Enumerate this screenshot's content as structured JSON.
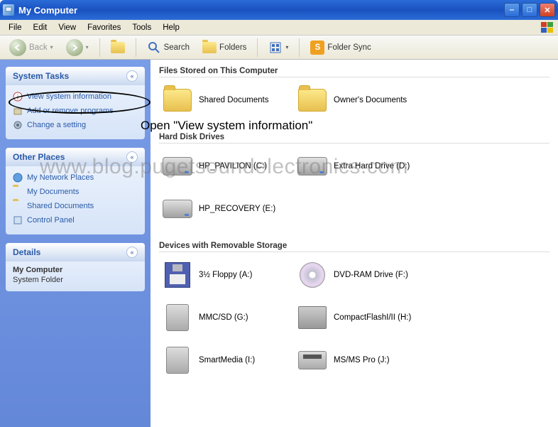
{
  "titlebar": {
    "title": "My Computer"
  },
  "menubar": {
    "items": [
      "File",
      "Edit",
      "View",
      "Favorites",
      "Tools",
      "Help"
    ]
  },
  "toolbar": {
    "back": "Back",
    "search": "Search",
    "folders": "Folders",
    "foldersync": "Folder Sync"
  },
  "sidebar": {
    "system_tasks": {
      "title": "System Tasks",
      "links": [
        {
          "label": "View system information"
        },
        {
          "label": "Add or remove programs"
        },
        {
          "label": "Change a setting"
        }
      ]
    },
    "other_places": {
      "title": "Other Places",
      "links": [
        {
          "label": "My Network Places"
        },
        {
          "label": "My Documents"
        },
        {
          "label": "Shared Documents"
        },
        {
          "label": "Control Panel"
        }
      ]
    },
    "details": {
      "title": "Details",
      "name": "My Computer",
      "type": "System Folder"
    }
  },
  "content": {
    "groups": [
      {
        "title": "Files Stored on This Computer",
        "items": [
          {
            "label": "Shared Documents",
            "icon": "folder"
          },
          {
            "label": "Owner's Documents",
            "icon": "folder"
          }
        ]
      },
      {
        "title": "Hard Disk Drives",
        "items": [
          {
            "label": "HP_PAVILION (C:)",
            "icon": "hdd"
          },
          {
            "label": "Extra Hard Drive (D:)",
            "icon": "hdd"
          },
          {
            "label": "HP_RECOVERY (E:)",
            "icon": "hdd"
          }
        ]
      },
      {
        "title": "Devices with Removable Storage",
        "items": [
          {
            "label": "3½ Floppy (A:)",
            "icon": "floppy"
          },
          {
            "label": "DVD-RAM Drive (F:)",
            "icon": "dvd"
          },
          {
            "label": "MMC/SD (G:)",
            "icon": "card"
          },
          {
            "label": "CompactFlashI/II (H:)",
            "icon": "cf"
          },
          {
            "label": "SmartMedia (I:)",
            "icon": "card"
          },
          {
            "label": "MS/MS Pro (J:)",
            "icon": "ms"
          }
        ]
      }
    ]
  },
  "annotation": {
    "instruction": "Open \"View system information\"",
    "watermark": "www.blog.pugetsoundelectronics.com"
  }
}
